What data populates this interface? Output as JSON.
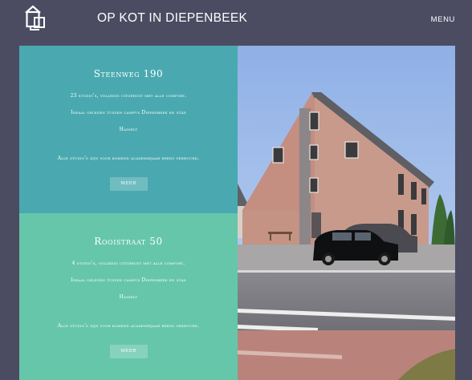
{
  "header": {
    "title": "OP KOT IN DIEPENBEEK",
    "menu_label": "MENU",
    "logo_icon": "house-logo-icon"
  },
  "listings": [
    {
      "title": "Steenweg 190",
      "line1": "23 studio's, volledig uitgerust met alle comfort.",
      "line2": "Ideaal gelegen tussen campus Diepenbeek en stad",
      "line3": "Hasselt",
      "line4": "Alle studio's zijn voor komend academiejaar reeds verhuurd.",
      "button": "MEER"
    },
    {
      "title": "Rooistraat 50",
      "line1": "4 studio's, volledig uitgerust met alle comfort.",
      "line2": "Ideaal gelegen tussen campus Diepenbeek en stad",
      "line3": "Hasselt",
      "line4": "Alle studio's zijn voor komend academiejaar reeds verhuurd.",
      "button": "MEER"
    }
  ],
  "colors": {
    "background": "#4b4c62",
    "panel_1": "#4aa9b0",
    "panel_2": "#66c6aa"
  }
}
